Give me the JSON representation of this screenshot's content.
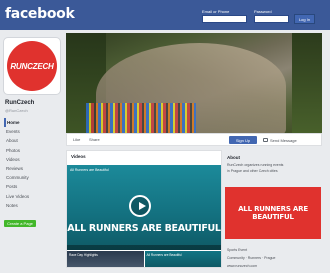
{
  "header": {
    "logo": "facebook",
    "email_label": "Email or Phone",
    "password_label": "Password",
    "login_button": "Log In"
  },
  "page": {
    "avatar_text": "RUNCZECH",
    "name": "RunCzech",
    "handle": "@RunCzech"
  },
  "nav": {
    "items": [
      "Home",
      "Events",
      "About",
      "Photos",
      "Videos",
      "Reviews",
      "Community",
      "Posts",
      "Live Videos",
      "Notes"
    ],
    "create_page": "Create a Page"
  },
  "cover_bar": {
    "like": "Like",
    "share": "Share",
    "sign_up": "Sign Up",
    "message": "Send Message"
  },
  "videos": {
    "header": "Videos",
    "video_title": "All Runners are Beautiful",
    "slogan": "ALL RUNNERS ARE BEAUTIFUL",
    "thumbs": [
      "Race Day Highlights",
      "All Runners are Beautiful"
    ]
  },
  "about": {
    "title": "About",
    "lines": [
      "RunCzech organizes running events",
      "in Prague and other Czech cities"
    ]
  },
  "promo": {
    "text": "ALL RUNNERS ARE BEAUTIFUL"
  },
  "right_links": [
    "Sports Event",
    "Community · Runners · Prague",
    "www.runczech.com"
  ],
  "colors": {
    "brand_blue": "#3b5998",
    "button_blue": "#4267b2",
    "accent_red": "#e0322e",
    "video_teal": "#13707f",
    "create_green": "#42b72a"
  }
}
